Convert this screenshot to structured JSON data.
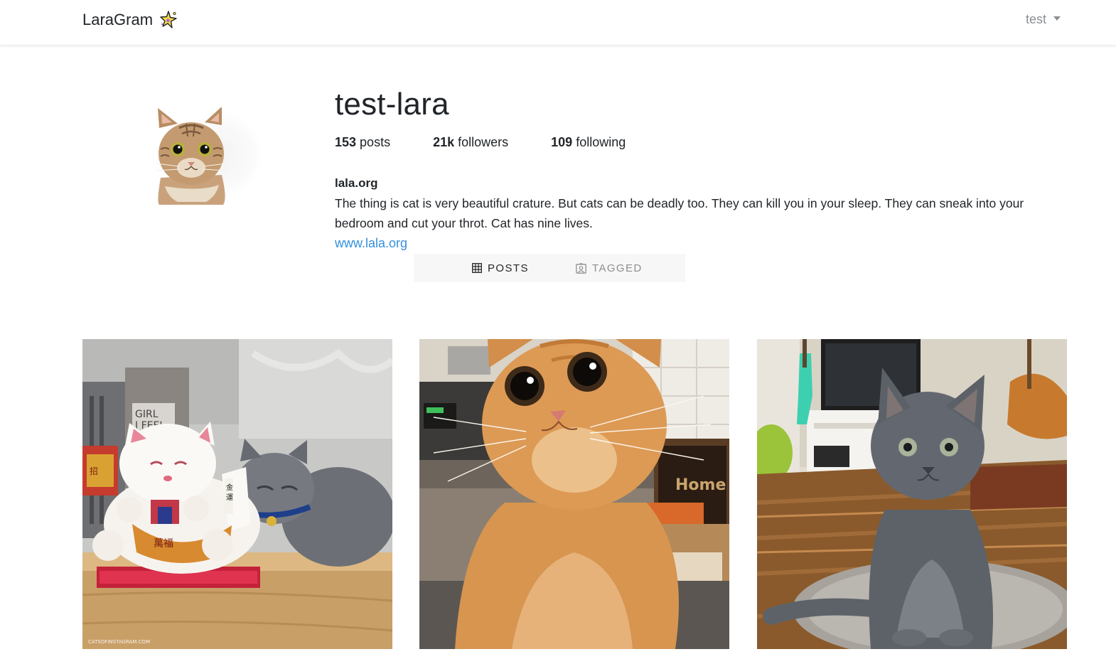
{
  "navbar": {
    "brand": "LaraGram",
    "brand_icon": "sparkle-icon",
    "user_menu_label": "test"
  },
  "profile": {
    "username": "test-lara",
    "stats": {
      "posts_count": "153",
      "posts_label": "posts",
      "followers_count": "21k",
      "followers_label": "followers",
      "following_count": "109",
      "following_label": "following"
    },
    "bio_title": "lala.org",
    "bio_description": "The thing is cat is very beautiful crature. But cats can be deadly too. They can kill you in your sleep. They can sneak into your bedroom and cut your throt. Cat has nine lives.",
    "bio_url": "www.lala.org"
  },
  "tabs": [
    {
      "label": "POSTS",
      "icon": "grid-icon",
      "active": true
    },
    {
      "label": "TAGGED",
      "icon": "tag-person-icon",
      "active": false
    }
  ],
  "posts": [
    {
      "alt": "gray cat sleeping beside lucky cat figurine",
      "watermark": "CATSOFINSTAGRAM.COM"
    },
    {
      "alt": "orange cat with wide eyes",
      "sign_text": "Home"
    },
    {
      "alt": "gray kitten on wooden floor"
    }
  ],
  "colors": {
    "link": "#3490dc",
    "tab_bg": "#f7f7f7",
    "muted": "#8a8f94"
  }
}
